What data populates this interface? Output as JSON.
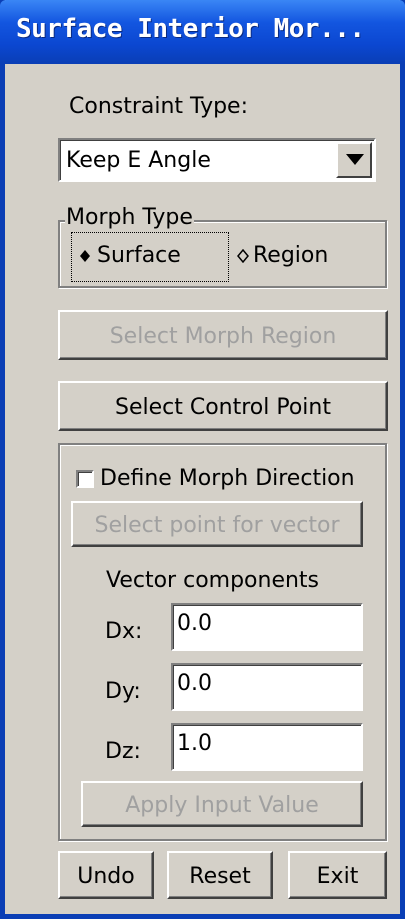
{
  "window": {
    "title": "Surface Interior Mor..."
  },
  "constraint": {
    "label": "Constraint Type:",
    "selected": "Keep E Angle"
  },
  "morph_type": {
    "legend": "Morph Type",
    "options": [
      {
        "label": "Surface",
        "selected": true
      },
      {
        "label": "Region",
        "selected": false
      }
    ]
  },
  "buttons": {
    "select_morph_region": "Select Morph Region",
    "select_control_point": "Select Control Point"
  },
  "direction": {
    "checkbox_label": "Define Morph Direction",
    "checked": false,
    "select_point_button": "Select point for vector",
    "vector_heading": "Vector components",
    "dx_label": "Dx:",
    "dx_value": "0.0",
    "dy_label": "Dy:",
    "dy_value": "0.0",
    "dz_label": "Dz:",
    "dz_value": "1.0",
    "apply_button": "Apply Input Value"
  },
  "footer": {
    "undo": "Undo",
    "reset": "Reset",
    "exit": "Exit"
  },
  "colors": {
    "title_bar": "#0a3eb5",
    "face": "#d4d0c8",
    "disabled_text": "#a0a0a0"
  },
  "icons": {
    "dropdown": "chevron-down-icon",
    "radio_selected": "diamond-filled-icon",
    "radio_unselected": "diamond-outline-icon"
  }
}
